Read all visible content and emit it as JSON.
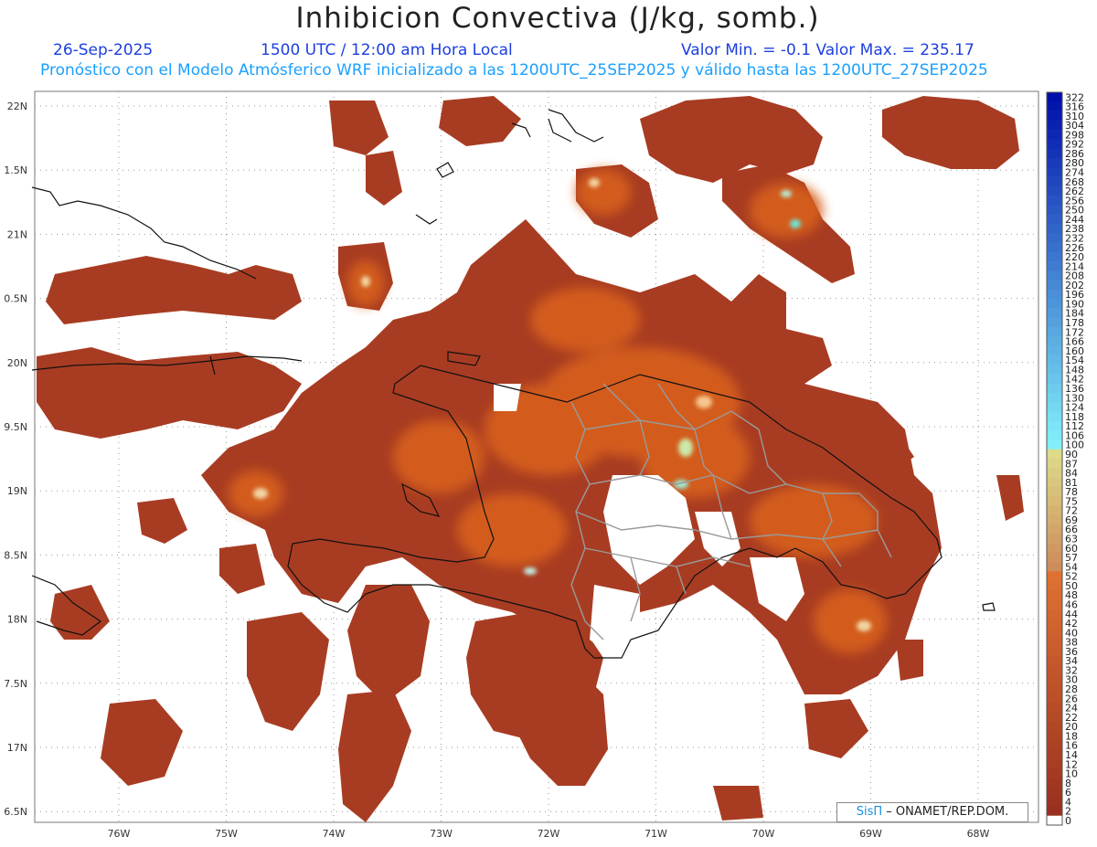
{
  "header": {
    "title": "Inhibicion Convectiva (J/kg, somb.)",
    "date": "26-Sep-2025",
    "time": "1500 UTC / 12:00 am Hora Local",
    "minmax": "Valor Min. = -0.1  Valor Max. = 235.17",
    "description": "Pronóstico con el Modelo Atmósferico WRF inicializado a las 1200UTC_25SEP2025 y válido hasta las  1200UTC_27SEP2025"
  },
  "axes": {
    "lat_labels": [
      "22N",
      "1.5N",
      "21N",
      "0.5N",
      "20N",
      "9.5N",
      "19N",
      "8.5N",
      "18N",
      "7.5N",
      "17N",
      "6.5N"
    ],
    "lon_labels": [
      "76W",
      "75W",
      "74W",
      "73W",
      "72W",
      "71W",
      "70W",
      "69W",
      "68W"
    ]
  },
  "colorbar": {
    "labels": [
      "322",
      "316",
      "310",
      "304",
      "298",
      "292",
      "286",
      "280",
      "274",
      "268",
      "262",
      "256",
      "250",
      "244",
      "238",
      "232",
      "226",
      "220",
      "214",
      "208",
      "202",
      "196",
      "190",
      "184",
      "178",
      "172",
      "166",
      "160",
      "154",
      "148",
      "142",
      "136",
      "130",
      "124",
      "118",
      "112",
      "106",
      "100",
      "90",
      "87",
      "84",
      "81",
      "78",
      "75",
      "72",
      "69",
      "66",
      "63",
      "60",
      "57",
      "54",
      "52",
      "50",
      "48",
      "46",
      "44",
      "42",
      "40",
      "38",
      "36",
      "34",
      "32",
      "30",
      "28",
      "26",
      "24",
      "22",
      "20",
      "18",
      "16",
      "14",
      "12",
      "10",
      "8",
      "6",
      "4",
      "2",
      "0"
    ]
  },
  "credit": {
    "brand": "SisΠ",
    "text": " – ONAMET/REP.DOM."
  },
  "colors": {
    "title": "#222222",
    "subtitle": "#1c3fe0",
    "description": "#1aa0ff",
    "field_base": "#a33a20",
    "field_warm": "#d9601c"
  }
}
